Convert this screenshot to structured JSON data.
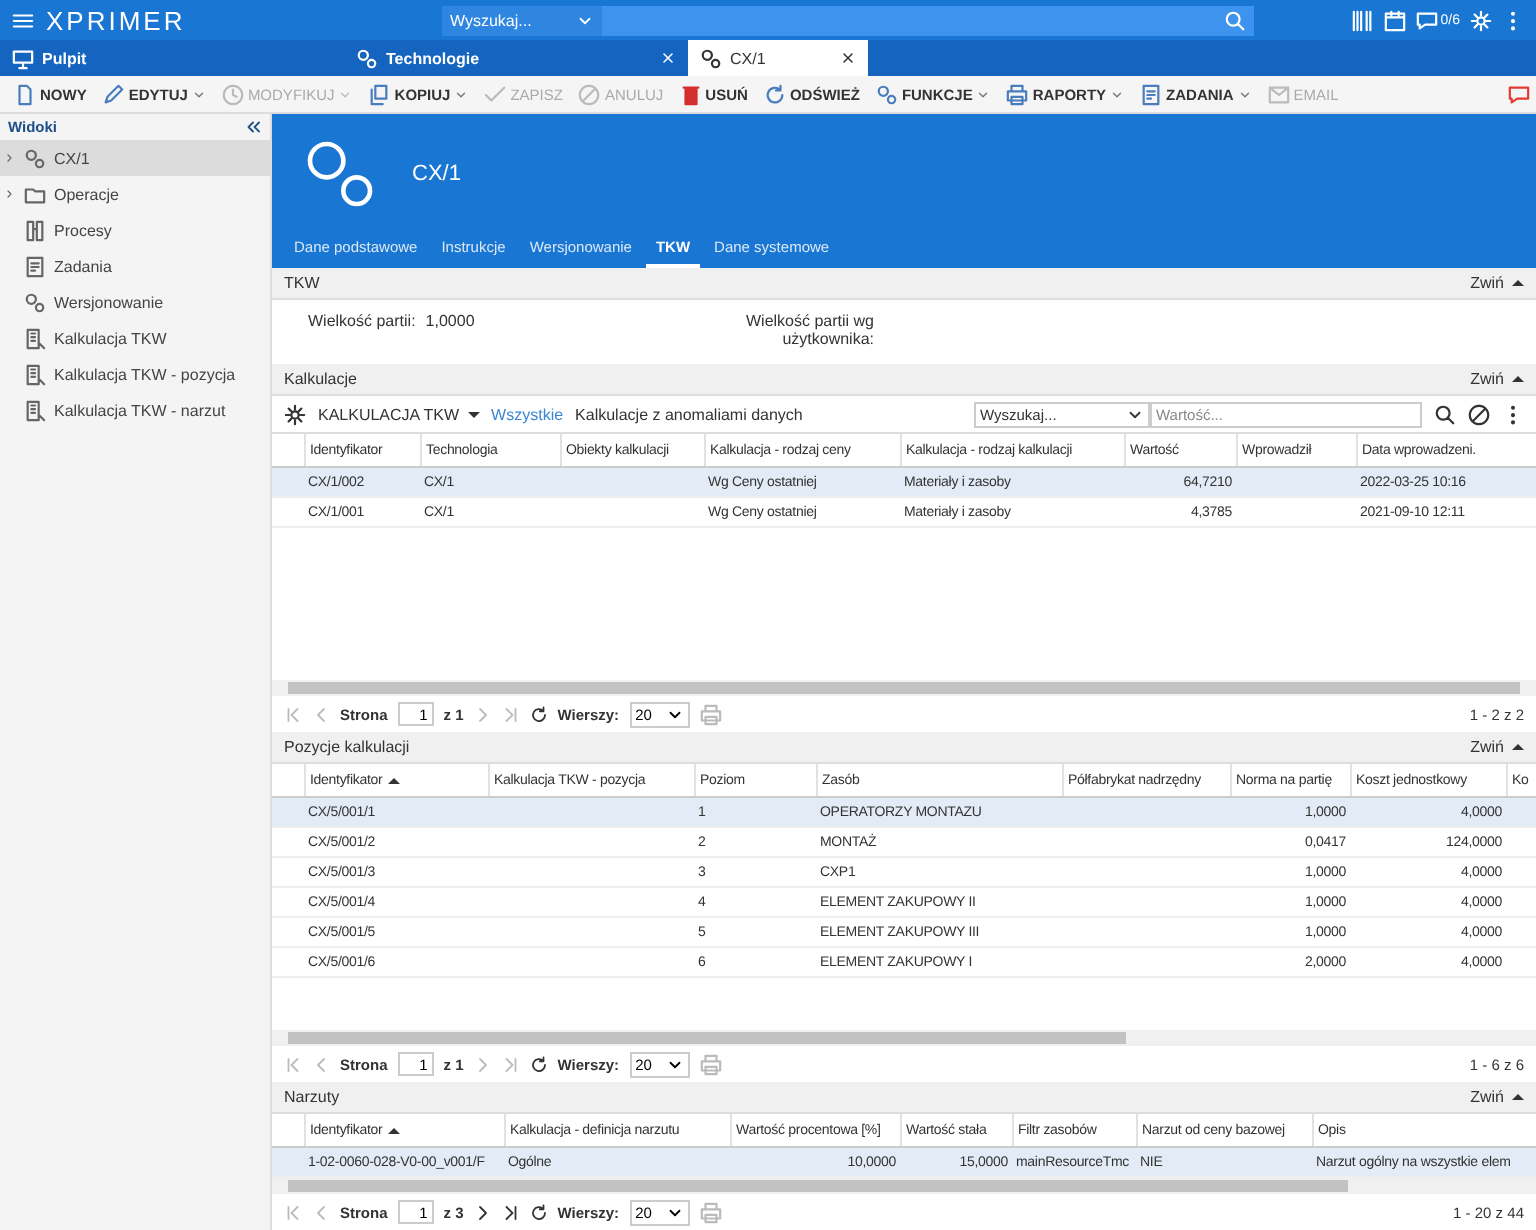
{
  "app": {
    "logo": "XPRIMER",
    "search_scope": "Wyszukaj...",
    "counter": "0/6"
  },
  "tabs": [
    {
      "label": "Pulpit",
      "selected": false,
      "closable": false
    },
    {
      "label": "Technologie",
      "selected": false,
      "closable": true
    },
    {
      "label": "CX/1",
      "selected": true,
      "closable": true
    }
  ],
  "toolbar": [
    {
      "label": "NOWY",
      "disabled": false,
      "dropdown": false
    },
    {
      "label": "EDYTUJ",
      "disabled": false,
      "dropdown": true
    },
    {
      "label": "MODYFIKUJ",
      "disabled": true,
      "dropdown": true
    },
    {
      "label": "KOPIUJ",
      "disabled": false,
      "dropdown": true
    },
    {
      "label": "ZAPISZ",
      "disabled": true,
      "dropdown": false
    },
    {
      "label": "ANULUJ",
      "disabled": true,
      "dropdown": false
    },
    {
      "label": "USUŃ",
      "disabled": false,
      "dropdown": false
    },
    {
      "label": "ODŚWIEŻ",
      "disabled": false,
      "dropdown": false
    },
    {
      "label": "FUNKCJE",
      "disabled": false,
      "dropdown": true
    },
    {
      "label": "RAPORTY",
      "disabled": false,
      "dropdown": true
    },
    {
      "label": "ZADANIA",
      "disabled": false,
      "dropdown": true
    },
    {
      "label": "EMAIL",
      "disabled": true,
      "dropdown": false
    }
  ],
  "sidebar": {
    "title": "Widoki",
    "items": [
      {
        "label": "CX/1",
        "selected": true,
        "expandable": true
      },
      {
        "label": "Operacje",
        "selected": false,
        "expandable": true
      },
      {
        "label": "Procesy",
        "selected": false,
        "expandable": false
      },
      {
        "label": "Zadania",
        "selected": false,
        "expandable": false
      },
      {
        "label": "Wersjonowanie",
        "selected": false,
        "expandable": false
      },
      {
        "label": "Kalkulacja TKW",
        "selected": false,
        "expandable": false
      },
      {
        "label": "Kalkulacja TKW - pozycja",
        "selected": false,
        "expandable": false
      },
      {
        "label": "Kalkulacja TKW - narzut",
        "selected": false,
        "expandable": false
      }
    ]
  },
  "record": {
    "title": "CX/1",
    "tabs": [
      {
        "label": "Dane podstawowe",
        "selected": false
      },
      {
        "label": "Instrukcje",
        "selected": false
      },
      {
        "label": "Wersjonowanie",
        "selected": false
      },
      {
        "label": "TKW",
        "selected": true
      },
      {
        "label": "Dane systemowe",
        "selected": false
      }
    ]
  },
  "tkw": {
    "title": "TKW",
    "collapse": "Zwiń",
    "fields": [
      {
        "label": "Wielkość partii:",
        "value": "1,0000"
      },
      {
        "label": "Wielkość partii wg użytkownika:"
      }
    ]
  },
  "grids": [
    {
      "title": "Kalkulacje",
      "collapse": "Zwiń",
      "view": "KALKULACJA TKW",
      "filters": [
        {
          "label": "Wszystkie",
          "selected": true
        },
        {
          "label": "Kalkulacje z anomaliami danych",
          "selected": false
        }
      ],
      "search_scope": "Wyszukaj...",
      "value_placeholder": "Wartość...",
      "columns": [
        {
          "label": "Identyfikator",
          "sorted": false
        },
        {
          "label": "Technologia",
          "sorted": false
        },
        {
          "label": "Obiekty kalkulacji",
          "sorted": false
        },
        {
          "label": "Kalkulacja - rodzaj ceny",
          "sorted": false
        },
        {
          "label": "Kalkulacja - rodzaj kalkulacji",
          "sorted": false
        },
        {
          "label": "Wartość",
          "sorted": false
        },
        {
          "label": "Wprowadził",
          "sorted": false
        },
        {
          "label": "Data wprowadzeni.",
          "sorted": false
        }
      ],
      "rows": [
        {
          "selected": true,
          "cells": [
            "CX/1/002",
            "CX/1",
            null,
            "Wg Ceny ostatniej",
            "Materiały i zasoby",
            "64,7210",
            null,
            "2022-03-25 10:16"
          ]
        },
        {
          "selected": false,
          "cells": [
            "CX/1/001",
            "CX/1",
            null,
            "Wg Ceny ostatniej",
            "Materiały i zasoby",
            "4,3785",
            null,
            "2021-09-10 12:11"
          ]
        }
      ],
      "pager": {
        "label": "Strona",
        "page": "1",
        "of": "z 1",
        "rows_label": "Wierszy:",
        "rows": "20",
        "range": "1 - 2 z 2",
        "next_enabled": false
      }
    },
    {
      "title": "Pozycje kalkulacji",
      "collapse": "Zwiń",
      "columns": [
        {
          "label": "Identyfikator",
          "sorted": true
        },
        {
          "label": "Kalkulacja TKW - pozycja",
          "sorted": false
        },
        {
          "label": "Poziom",
          "sorted": false
        },
        {
          "label": "Zasób",
          "sorted": false
        },
        {
          "label": "Półfabrykat nadrzędny",
          "sorted": false
        },
        {
          "label": "Norma na partię",
          "sorted": false
        },
        {
          "label": "Koszt jednostkowy",
          "sorted": false
        },
        {
          "label": "Ko",
          "sorted": false
        }
      ],
      "rows": [
        {
          "selected": true,
          "cells": [
            "CX/5/001/1",
            null,
            "1",
            "OPERATORZY MONTAZU",
            null,
            "1,0000",
            "4,0000",
            null
          ]
        },
        {
          "selected": false,
          "cells": [
            "CX/5/001/2",
            null,
            "2",
            "MONTAŻ",
            null,
            "0,0417",
            "124,0000",
            null
          ]
        },
        {
          "selected": false,
          "cells": [
            "CX/5/001/3",
            null,
            "3",
            "CXP1",
            null,
            "1,0000",
            "4,0000",
            null
          ]
        },
        {
          "selected": false,
          "cells": [
            "CX/5/001/4",
            null,
            "4",
            "ELEMENT ZAKUPOWY II",
            null,
            "1,0000",
            "4,0000",
            null
          ]
        },
        {
          "selected": false,
          "cells": [
            "CX/5/001/5",
            null,
            "5",
            "ELEMENT ZAKUPOWY III",
            null,
            "1,0000",
            "4,0000",
            null
          ]
        },
        {
          "selected": false,
          "cells": [
            "CX/5/001/6",
            null,
            "6",
            "ELEMENT ZAKUPOWY I",
            null,
            "2,0000",
            "4,0000",
            null
          ]
        }
      ],
      "pager": {
        "label": "Strona",
        "page": "1",
        "of": "z 1",
        "rows_label": "Wierszy:",
        "rows": "20",
        "range": "1 - 6 z 6",
        "next_enabled": false
      }
    },
    {
      "title": "Narzuty",
      "collapse": "Zwiń",
      "columns": [
        {
          "label": "Identyfikator",
          "sorted": true
        },
        {
          "label": "Kalkulacja - definicja narzutu",
          "sorted": false
        },
        {
          "label": "Wartość procentowa [%]",
          "sorted": false
        },
        {
          "label": "Wartość stała",
          "sorted": false
        },
        {
          "label": "Filtr zasobów",
          "sorted": false
        },
        {
          "label": "Narzut od ceny bazowej",
          "sorted": false
        },
        {
          "label": "Opis",
          "sorted": false
        }
      ],
      "rows": [
        {
          "selected": true,
          "cells": [
            "1-02-0060-028-V0-00_v001/F",
            "Ogólne",
            "10,0000",
            "15,0000",
            "mainResourceTmc",
            "NIE",
            "Narzut ogólny na wszystkie elem"
          ]
        }
      ],
      "pager": {
        "label": "Strona",
        "page": "1",
        "of": "z 3",
        "rows_label": "Wierszy:",
        "rows": "20",
        "range": "1 - 20 z 44",
        "next_enabled": true
      }
    }
  ]
}
